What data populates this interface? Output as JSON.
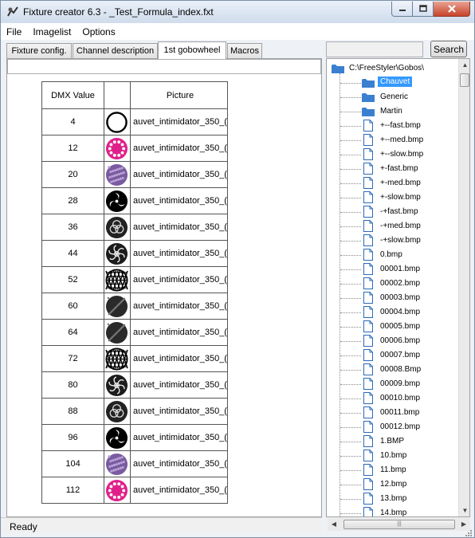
{
  "window": {
    "title": "Fixture creator 6.3 - _Test_Formula_index.fxt"
  },
  "menu": [
    "File",
    "Imagelist",
    "Options"
  ],
  "tabs": [
    {
      "label": "Fixture config."
    },
    {
      "label": "Channel description"
    },
    {
      "label": "1st gobowheel",
      "active": true
    },
    {
      "label": "Macros"
    }
  ],
  "search": {
    "value": "",
    "button_label": "Search"
  },
  "gobo_table": {
    "headers": {
      "dmx": "DMX Value",
      "image": "",
      "picture": "Picture"
    },
    "rows": [
      {
        "dmx": "4",
        "picture": "auvet_intimidator_350_(",
        "icon": "open-circle-icon"
      },
      {
        "dmx": "12",
        "picture": "auvet_intimidator_350_(",
        "icon": "magenta-dots-gobo-icon"
      },
      {
        "dmx": "20",
        "picture": "auvet_intimidator_350_(",
        "icon": "purple-texture-gobo-icon"
      },
      {
        "dmx": "28",
        "picture": "auvet_intimidator_350_(",
        "icon": "swirl-gobo-icon"
      },
      {
        "dmx": "36",
        "picture": "auvet_intimidator_350_(",
        "icon": "triple-ring-gobo-icon"
      },
      {
        "dmx": "44",
        "picture": "auvet_intimidator_350_(",
        "icon": "rose-gobo-icon"
      },
      {
        "dmx": "52",
        "picture": "auvet_intimidator_350_(",
        "icon": "grid-gobo-icon"
      },
      {
        "dmx": "60",
        "picture": "auvet_intimidator_350_(",
        "icon": "dark-texture-gobo-icon"
      },
      {
        "dmx": "64",
        "picture": "auvet_intimidator_350_(",
        "icon": "dark-texture-gobo-icon"
      },
      {
        "dmx": "72",
        "picture": "auvet_intimidator_350_(",
        "icon": "grid-gobo-icon"
      },
      {
        "dmx": "80",
        "picture": "auvet_intimidator_350_(",
        "icon": "rose-gobo-icon"
      },
      {
        "dmx": "88",
        "picture": "auvet_intimidator_350_(",
        "icon": "triple-ring-gobo-icon"
      },
      {
        "dmx": "96",
        "picture": "auvet_intimidator_350_(",
        "icon": "swirl-gobo-icon"
      },
      {
        "dmx": "104",
        "picture": "auvet_intimidator_350_(",
        "icon": "purple-texture-gobo-icon"
      },
      {
        "dmx": "112",
        "picture": "auvet_intimidator_350_(",
        "icon": "magenta-dots-gobo-icon"
      }
    ]
  },
  "tree": {
    "root": "C:\\FreeStyler\\Gobos\\",
    "folders": [
      "Chauvet",
      "Generic",
      "Martin"
    ],
    "selected_folder": "Chauvet",
    "files": [
      "+--fast.bmp",
      "+--med.bmp",
      "+--slow.bmp",
      "+-fast.bmp",
      "+-med.bmp",
      "+-slow.bmp",
      "-+fast.bmp",
      "-+med.bmp",
      "-+slow.bmp",
      "0.bmp",
      "00001.bmp",
      "00002.bmp",
      "00003.bmp",
      "00004.bmp",
      "00005.bmp",
      "00006.bmp",
      "00007.bmp",
      "00008.Bmp",
      "00009.bmp",
      "00010.bmp",
      "00011.bmp",
      "00012.bmp",
      "1.BMP",
      "10.bmp",
      "11.bmp",
      "12.bmp",
      "13.bmp",
      "14.bmp"
    ]
  },
  "status": {
    "text": "Ready"
  },
  "colors": {
    "selection": "#3399ff",
    "folder": "#3a7fd0",
    "gobo_magenta": "#e0208a",
    "gobo_purple": "#7a5aa0"
  }
}
